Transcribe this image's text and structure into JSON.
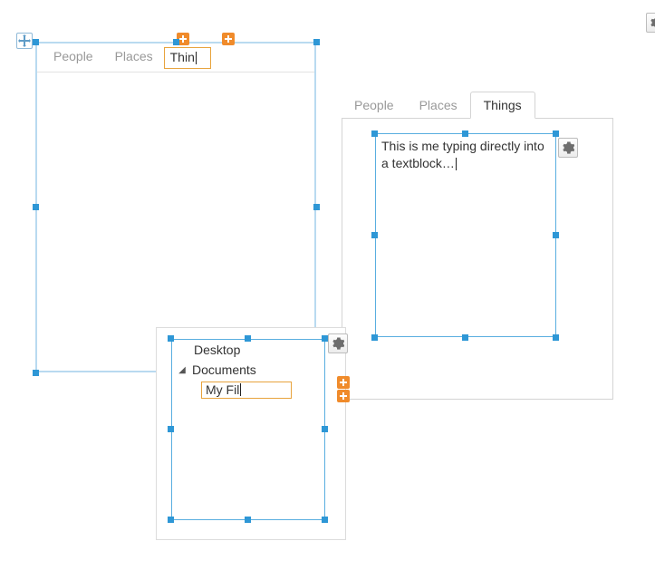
{
  "panel1": {
    "tabs": [
      {
        "label": "People"
      },
      {
        "label": "Places"
      },
      {
        "label": "Thin",
        "editing": true
      }
    ]
  },
  "panel2": {
    "tabs": [
      {
        "label": "People"
      },
      {
        "label": "Places"
      },
      {
        "label": "Things",
        "active": true
      }
    ],
    "textblock": "This is me typing directly into a textblock…"
  },
  "panel3": {
    "tree": {
      "node0": "Desktop",
      "node1": "Documents",
      "node1_expanded": true,
      "node1_child_editing": "My Fil"
    }
  },
  "icons": {
    "gear": "settings-gear",
    "move": "move-handle",
    "plus": "insert-plus"
  }
}
